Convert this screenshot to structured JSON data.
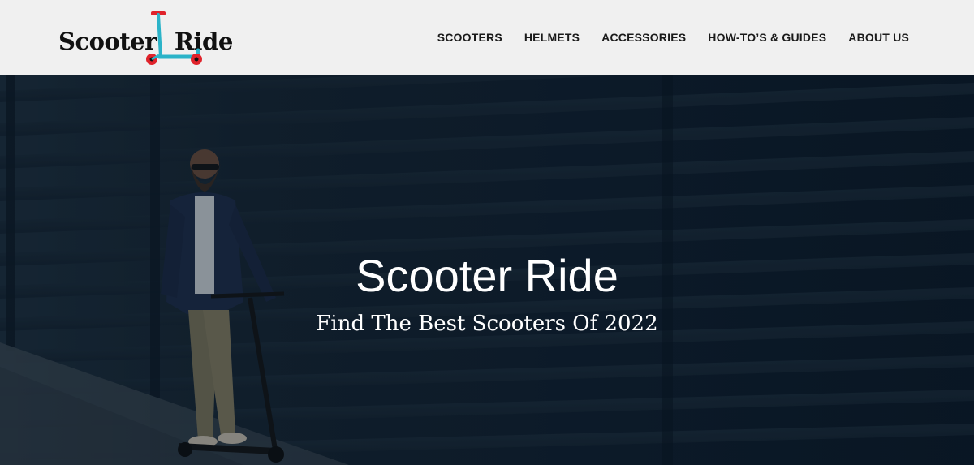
{
  "header": {
    "logo": {
      "word1": "Scooter",
      "word2": "Ride",
      "scooter_icon": "scooter-logo-icon"
    },
    "nav": [
      {
        "label": "SCOOTERS"
      },
      {
        "label": "HELMETS"
      },
      {
        "label": "ACCESSORIES"
      },
      {
        "label": "HOW-TO’S & GUIDES"
      },
      {
        "label": "ABOUT US"
      }
    ]
  },
  "hero": {
    "title": "Scooter Ride",
    "subtitle": "Find The Best Scooters Of 2022"
  },
  "colors": {
    "header_bg": "#f0f0f0",
    "nav_text": "#1a1a1a",
    "logo_scooter_blue": "#2bb3c8",
    "logo_scooter_red": "#e0232b",
    "hero_bg": "#122130",
    "hero_text": "#ffffff"
  }
}
